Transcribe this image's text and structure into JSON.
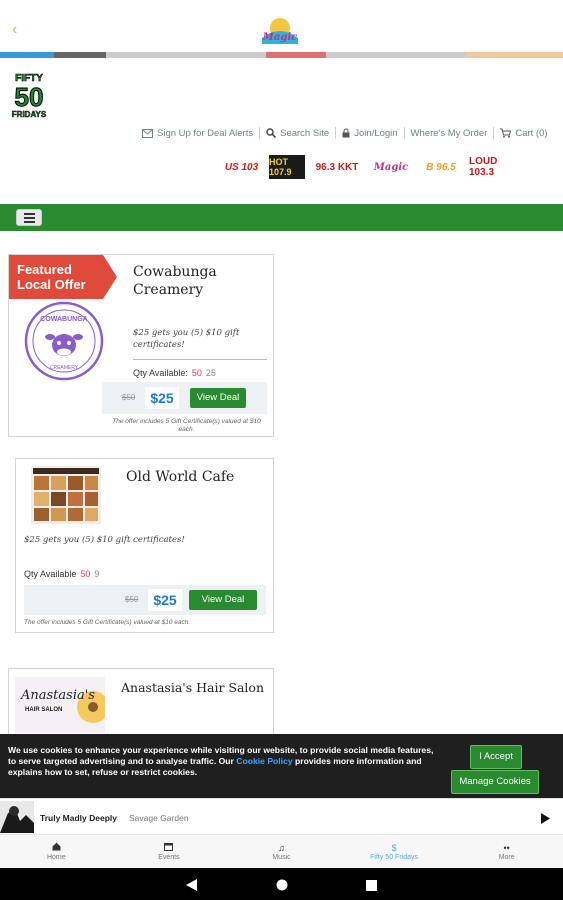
{
  "app": {
    "back_icon": "chevron-left-icon",
    "logo_name": "station-logo"
  },
  "colors": {
    "brand_green": "#2a8a2f",
    "strip": [
      "#3a9ad9",
      "#666666",
      "#cccccc",
      "#e07070",
      "#cccccc",
      "#f0c8a0"
    ],
    "link_blue": "#1f78c8",
    "old_qty_red": "#e04040"
  },
  "site": {
    "logo_lines": [
      "FIFTY",
      "50",
      "FRIDAYS"
    ],
    "top_links": [
      {
        "icon": "envelope-icon",
        "label": "Sign Up for Deal Alerts"
      },
      {
        "icon": "search-icon",
        "label": "Search Site"
      },
      {
        "icon": "lock-icon",
        "label": "Join/Login"
      },
      {
        "icon": "",
        "label": "Where's My Order"
      },
      {
        "icon": "cart-icon",
        "label": "Cart (0)"
      }
    ],
    "stations": [
      "US 103",
      "HOT 107.9",
      "96.3 KKT",
      "Magic",
      "B 96.5",
      "LOUD 103.3"
    ]
  },
  "deals": [
    {
      "featured_label": "Featured Local Offer",
      "title": "Cowabunga Creamery",
      "description": "$25 gets you (5) $10 gift certificates!",
      "qty_label": "Qty Available:",
      "qty_old": "50",
      "qty_current": "25",
      "old_price": "$50",
      "price": "$25",
      "button": "View Deal",
      "note": "The offer includes 5 Gift Certificate(s) valued at $10 each.",
      "logo_text": "COWABUNGA",
      "logo_sub": "CREAMERY"
    },
    {
      "title": "Old World Cafe",
      "description": "$25 gets you (5) $10 gift certificates!",
      "qty_label": "Qty Available",
      "qty_old": "50",
      "qty_current": "9",
      "old_price": "$50",
      "price": "$25",
      "button": "View Deal",
      "note": "The offer includes 5 Gift Certificate(s) valued at $10 each."
    },
    {
      "title": "Anastasia's Hair Salon",
      "logo_text": "Anastasia's",
      "logo_sub": "HAIR SALON"
    }
  ],
  "cookie": {
    "text_before": "We use cookies to enhance your experience while visiting our website, to provide social media features, to serve targeted advertising and to analyse traffic. Our ",
    "link": "Cookie Policy",
    "text_after": " provides more information and explains how to set, refuse or restrict cookies.",
    "accept": "I Accept",
    "manage": "Manage Cookies"
  },
  "player": {
    "song": "Truly Madly Deeply",
    "artist": "Savage Garden",
    "play_icon": "play-icon"
  },
  "tabs": [
    {
      "icon": "home-icon",
      "label": "Home",
      "active": false
    },
    {
      "icon": "calendar-icon",
      "label": "Events",
      "active": false
    },
    {
      "icon": "music-note-icon",
      "label": "Music",
      "active": false
    },
    {
      "icon": "dollar-icon",
      "label": "Fifty 50 Fridays",
      "active": true
    },
    {
      "icon": "more-icon",
      "label": "More",
      "active": false
    }
  ]
}
